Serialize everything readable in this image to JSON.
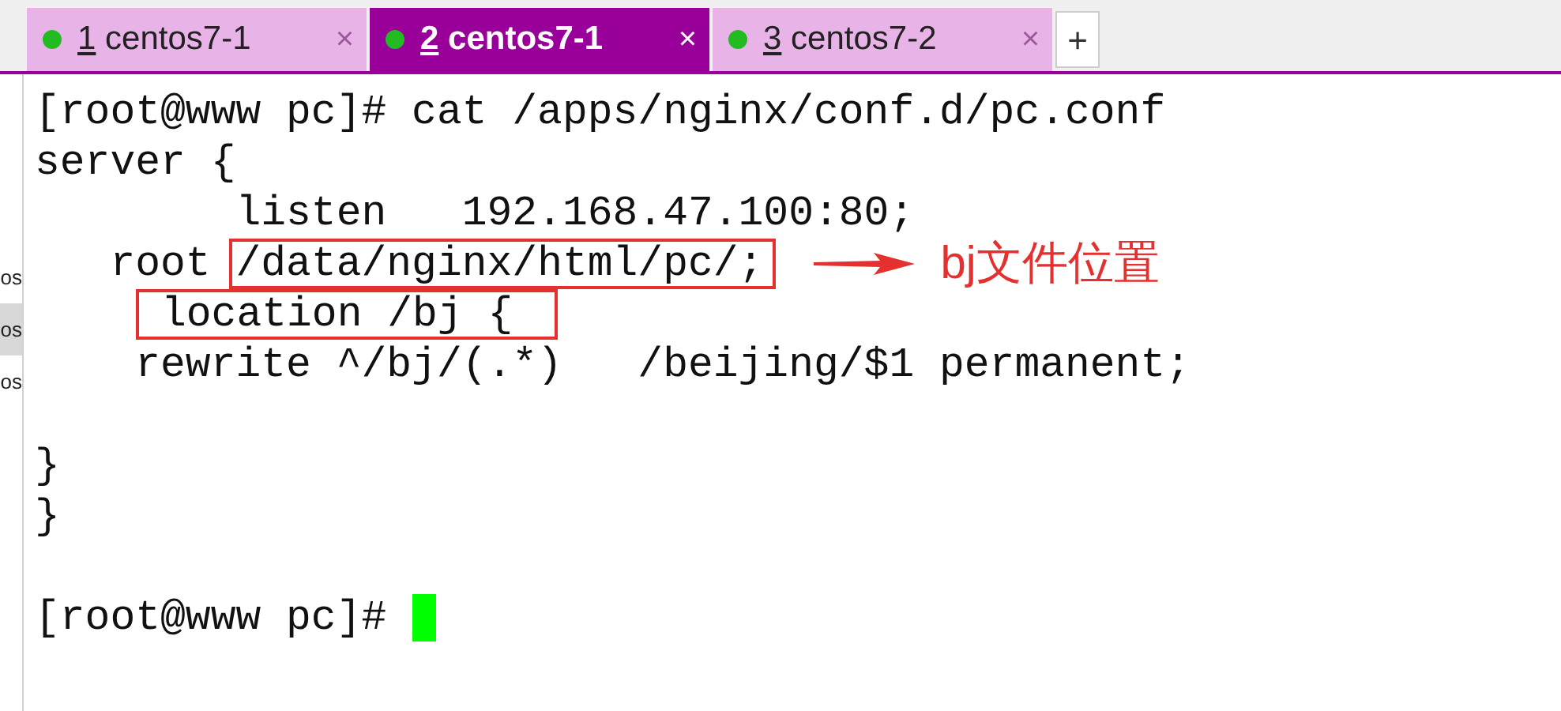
{
  "tabs": [
    {
      "number": "1",
      "label": "centos7-1",
      "selected": false,
      "close": "×"
    },
    {
      "number": "2",
      "label": "centos7-1",
      "selected": true,
      "close": "×"
    },
    {
      "number": "3",
      "label": "centos7-2",
      "selected": false,
      "close": "×"
    }
  ],
  "new_tab": "+",
  "side_strip": [
    {
      "text": "os",
      "selected": false
    },
    {
      "text": "os",
      "selected": true
    },
    {
      "text": "os",
      "selected": false
    }
  ],
  "terminal": {
    "lines": [
      {
        "segments": [
          {
            "text": "[root@www pc]# cat /apps/nginx/conf.d/pc.conf",
            "boxed": false
          }
        ]
      },
      {
        "segments": [
          {
            "text": "server {",
            "boxed": false
          }
        ]
      },
      {
        "segments": [
          {
            "text": "        listen   192.168.47.100:80;",
            "boxed": false
          }
        ]
      },
      {
        "segments": [
          {
            "text": "   root ",
            "boxed": false
          },
          {
            "text": "/data/nginx/html/pc/;",
            "boxed": true
          }
        ],
        "annotation": "bj文件位置"
      },
      {
        "segments": [
          {
            "text": "location /bj {",
            "boxed": true
          }
        ]
      },
      {
        "segments": [
          {
            "text": "    rewrite ^/bj/(.*)   /beijing/$1 permanent;",
            "boxed": false
          }
        ]
      },
      {
        "blank": true
      },
      {
        "segments": [
          {
            "text": "}",
            "boxed": false
          }
        ]
      },
      {
        "segments": [
          {
            "text": "}",
            "boxed": false
          }
        ]
      },
      {
        "blank": true
      },
      {
        "segments": [
          {
            "text": "[root@www pc]# ",
            "boxed": false
          }
        ],
        "cursor": true
      }
    ]
  }
}
